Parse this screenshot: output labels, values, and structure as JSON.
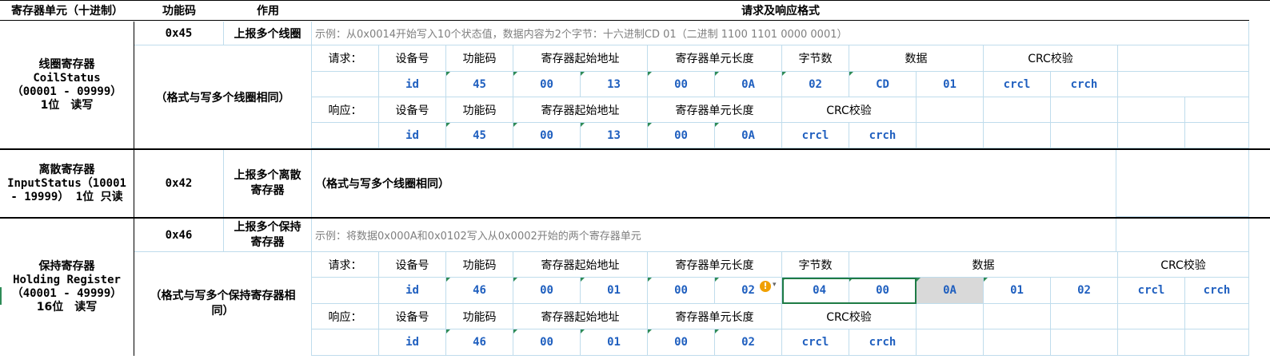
{
  "headers": {
    "unit": "寄存器单元（十进制）",
    "func": "功能码",
    "role": "作用",
    "format": "请求及响应格式"
  },
  "coil": {
    "name": "线圈寄存器",
    "eng": "CoilStatus",
    "range": "（00001 - 09999）",
    "bits": "1位　读写",
    "code": "0x45",
    "role": "上报多个线圈",
    "example": "示例：从0x0014开始写入10个状态值，数据内容为2个字节：十六进制CD 01（二进制 1100 1101 0000 0001）",
    "note": "（格式与写多个线圈相同）",
    "req_label": "请求：",
    "req_headers": [
      "设备号",
      "功能码",
      "寄存器起始地址",
      "寄存器单元长度",
      "字节数",
      "数据",
      "CRC校验"
    ],
    "req_values": [
      "id",
      "45",
      "00",
      "13",
      "00",
      "0A",
      "02",
      "CD",
      "01",
      "crcl",
      "crch"
    ],
    "resp_label": "响应：",
    "resp_headers": [
      "设备号",
      "功能码",
      "寄存器起始地址",
      "寄存器单元长度",
      "CRC校验"
    ],
    "resp_values": [
      "id",
      "45",
      "00",
      "13",
      "00",
      "0A",
      "crcl",
      "crch"
    ]
  },
  "input": {
    "name": "离散寄存器",
    "line2": "InputStatus（10001",
    "line3": "- 19999） 1位 只读",
    "code": "0x42",
    "role1": "上报多个离散",
    "role2": "寄存器",
    "note": "（格式与写多个线圈相同）"
  },
  "holding": {
    "name": "保持寄存器",
    "eng": "Holding Register",
    "range": "（40001 - 49999）",
    "bits": "16位　读写",
    "code": "0x46",
    "role1": "上报多个保持",
    "role2": "寄存器",
    "example": "示例：将数据0x000A和0x0102写入从0x0002开始的两个寄存器单元",
    "note1": "（格式与写多个保持寄存器相",
    "note2": "同）",
    "req_label": "请求：",
    "req_headers": [
      "设备号",
      "功能码",
      "寄存器起始地址",
      "寄存器单元长度",
      "字节数",
      "数据",
      "CRC校验"
    ],
    "req_values": [
      "id",
      "46",
      "00",
      "01",
      "00",
      "02",
      "04",
      "00",
      "0A",
      "01",
      "02",
      "crcl",
      "crch"
    ],
    "resp_label": "响应：",
    "resp_headers": [
      "设备号",
      "功能码",
      "寄存器起始地址",
      "寄存器单元长度",
      "CRC校验"
    ],
    "resp_values": [
      "id",
      "46",
      "00",
      "01",
      "00",
      "02",
      "crcl",
      "crch"
    ]
  },
  "warn_symbol": "!"
}
